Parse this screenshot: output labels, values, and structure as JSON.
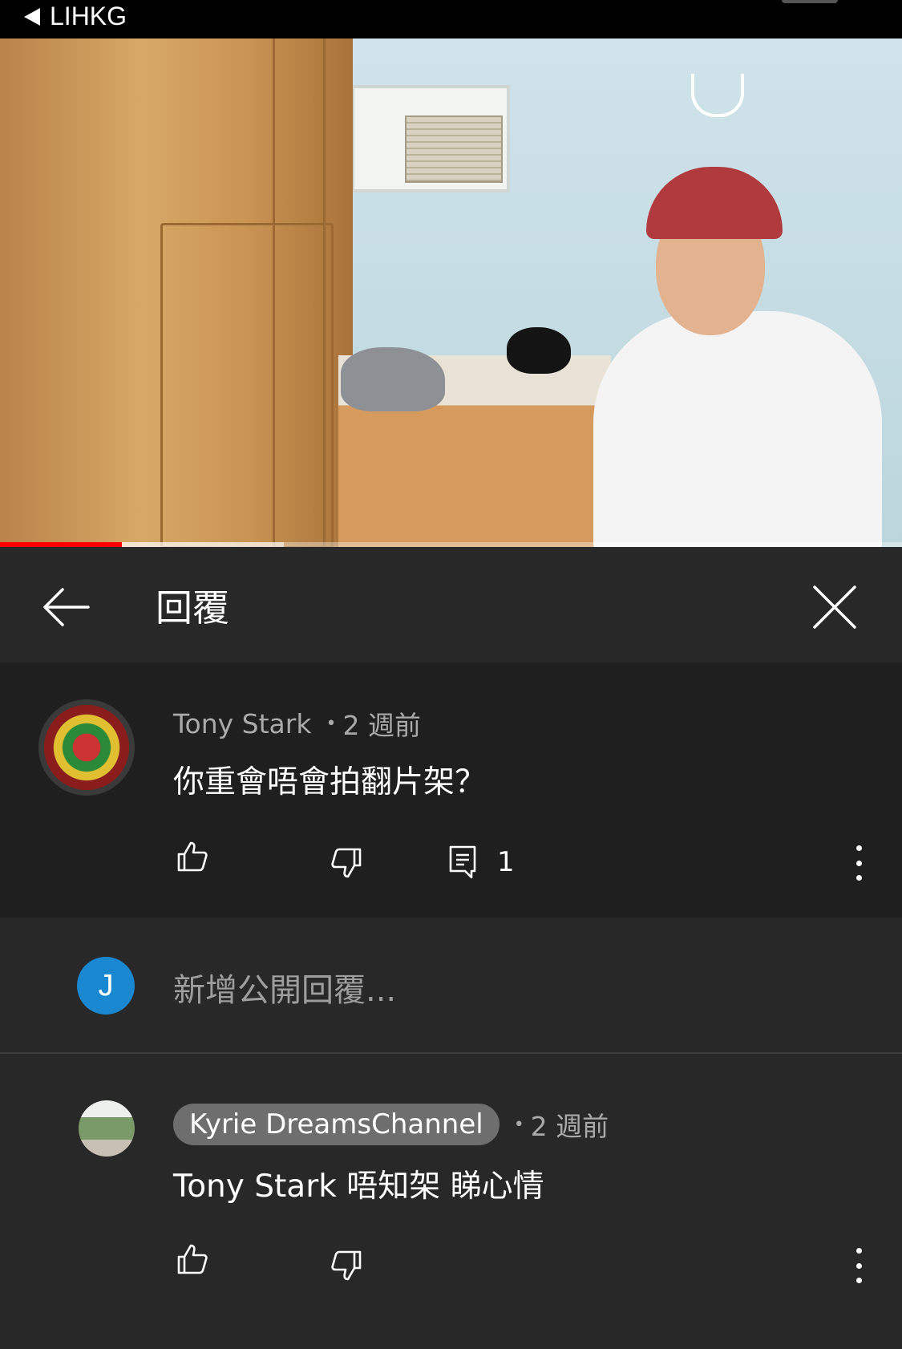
{
  "status_bar": {
    "back_app_label": "LIHKG"
  },
  "video": {
    "progress": 0.135,
    "buffered": 0.315
  },
  "header": {
    "title": "回覆"
  },
  "top_comment": {
    "author": "Tony Stark",
    "time": "2 週前",
    "text": "你重會唔會拍翻片架？",
    "reply_count": "1"
  },
  "add_reply": {
    "avatar_letter": "J",
    "placeholder": "新增公開回覆..."
  },
  "reply": {
    "author": "Kyrie DreamsChannel",
    "time": "2 週前",
    "text": "Tony Stark 唔知架 睇心情"
  },
  "colors": {
    "accent_red": "#ff0000",
    "avatar_blue": "#1a88d1",
    "background": "#282828",
    "comment_bg": "#1f1f1f"
  }
}
